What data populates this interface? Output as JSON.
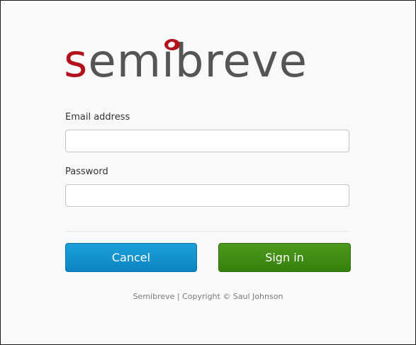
{
  "app": {
    "logo": {
      "word": "semibreve",
      "accent_color": "#b3121c",
      "text_color": "#555557"
    }
  },
  "form": {
    "email_label": "Email address",
    "email_value": "",
    "password_label": "Password",
    "password_value": "",
    "cancel_label": "Cancel",
    "signin_label": "Sign in"
  },
  "footer": {
    "text": "Semibreve | Copyright © Saul Johnson"
  },
  "colors": {
    "cancel_button": "#1497cf",
    "signin_button": "#3f8c14",
    "background": "#f9f9f9"
  }
}
